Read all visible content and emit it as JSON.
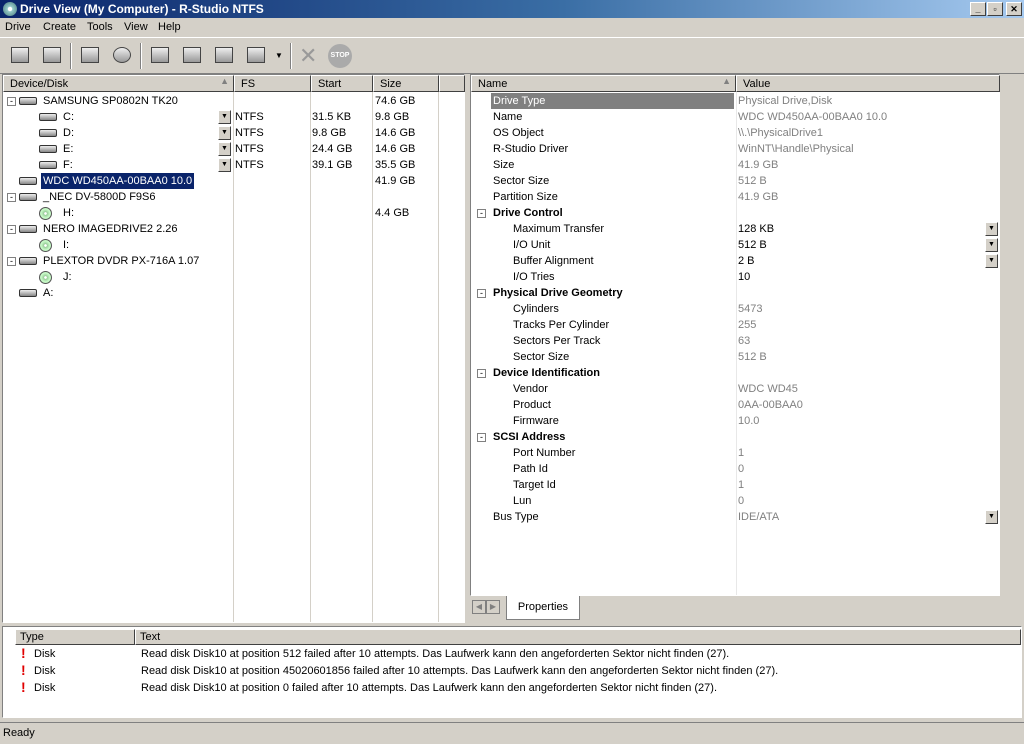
{
  "window": {
    "title": "Drive View (My Computer) - R-Studio NTFS",
    "min": "_",
    "max": "▫",
    "close": "✕"
  },
  "menu": [
    "Drive",
    "Create",
    "Tools",
    "View",
    "Help"
  ],
  "toolbar": {
    "icons": [
      "computer-icon",
      "network-icon",
      "scan-icon",
      "search-network-icon",
      "open-image-icon",
      "create-image-icon",
      "region-icon",
      "properties-icon",
      "dropdown-icon",
      "delete-icon",
      "stop-icon"
    ],
    "stop_label": "STOP"
  },
  "left": {
    "headers": {
      "device": "Device/Disk",
      "fs": "FS",
      "start": "Start",
      "size": "Size"
    },
    "rows": [
      {
        "name": "SAMSUNG SP0802N TK20",
        "fs": "",
        "start": "",
        "size": "74.6 GB"
      },
      {
        "name": "C:",
        "fs": "NTFS",
        "start": "31.5 KB",
        "size": "9.8 GB"
      },
      {
        "name": "D:",
        "fs": "NTFS",
        "start": "9.8 GB",
        "size": "14.6 GB"
      },
      {
        "name": "E:",
        "fs": "NTFS",
        "start": "24.4 GB",
        "size": "14.6 GB"
      },
      {
        "name": "F:",
        "fs": "NTFS",
        "start": "39.1 GB",
        "size": "35.5 GB"
      },
      {
        "name": "WDC WD450AA-00BAA0 10.0",
        "fs": "",
        "start": "",
        "size": "41.9 GB"
      },
      {
        "name": "_NEC DV-5800D F9S6",
        "fs": "",
        "start": "",
        "size": ""
      },
      {
        "name": "H:",
        "fs": "",
        "start": "",
        "size": "4.4 GB"
      },
      {
        "name": "NERO IMAGEDRIVE2 2.26",
        "fs": "",
        "start": "",
        "size": ""
      },
      {
        "name": "I:",
        "fs": "",
        "start": "",
        "size": ""
      },
      {
        "name": "PLEXTOR DVDR PX-716A 1.07",
        "fs": "",
        "start": "",
        "size": ""
      },
      {
        "name": "J:",
        "fs": "",
        "start": "",
        "size": ""
      },
      {
        "name": "A:",
        "fs": "",
        "start": "",
        "size": ""
      }
    ]
  },
  "right": {
    "headers": {
      "name": "Name",
      "value": "Value"
    },
    "rows": [
      {
        "name": "Drive Type",
        "value": "Physical Drive,Disk"
      },
      {
        "name": "Name",
        "value": "WDC WD450AA-00BAA0 10.0"
      },
      {
        "name": "OS Object",
        "value": "\\\\.\\PhysicalDrive1"
      },
      {
        "name": "R-Studio Driver",
        "value": "WinNT\\Handle\\Physical"
      },
      {
        "name": "Size",
        "value": "41.9 GB"
      },
      {
        "name": "Sector Size",
        "value": "512 B"
      },
      {
        "name": "Partition Size",
        "value": "41.9 GB"
      },
      {
        "name": "Drive Control",
        "value": ""
      },
      {
        "name": "Maximum Transfer",
        "value": "128 KB"
      },
      {
        "name": "I/O Unit",
        "value": "512 B"
      },
      {
        "name": "Buffer Alignment",
        "value": "2 B"
      },
      {
        "name": "I/O Tries",
        "value": "10"
      },
      {
        "name": "Physical Drive Geometry",
        "value": ""
      },
      {
        "name": "Cylinders",
        "value": "5473"
      },
      {
        "name": "Tracks Per Cylinder",
        "value": "255"
      },
      {
        "name": "Sectors Per Track",
        "value": "63"
      },
      {
        "name": "Sector Size",
        "value": "512 B"
      },
      {
        "name": "Device Identification",
        "value": ""
      },
      {
        "name": "Vendor",
        "value": "WDC WD45"
      },
      {
        "name": "Product",
        "value": "0AA-00BAA0"
      },
      {
        "name": "Firmware",
        "value": "10.0"
      },
      {
        "name": "SCSI Address",
        "value": ""
      },
      {
        "name": "Port Number",
        "value": "1"
      },
      {
        "name": "Path Id",
        "value": "0"
      },
      {
        "name": "Target Id",
        "value": "1"
      },
      {
        "name": "Lun",
        "value": "0"
      },
      {
        "name": "Bus Type",
        "value": "IDE/ATA"
      }
    ],
    "tab": "Properties"
  },
  "log": {
    "headers": {
      "type": "Type",
      "text": "Text"
    },
    "rows": [
      {
        "type": "Disk",
        "text": "Read disk Disk10 at position 512 failed after 10 attempts. Das Laufwerk kann den angeforderten Sektor nicht finden (27)."
      },
      {
        "type": "Disk",
        "text": "Read disk Disk10 at position 45020601856 failed after 10 attempts. Das Laufwerk kann den angeforderten Sektor nicht finden (27)."
      },
      {
        "type": "Disk",
        "text": "Read disk Disk10 at position 0 failed after 10 attempts. Das Laufwerk kann den angeforderten Sektor nicht finden (27)."
      }
    ]
  },
  "status": "Ready"
}
